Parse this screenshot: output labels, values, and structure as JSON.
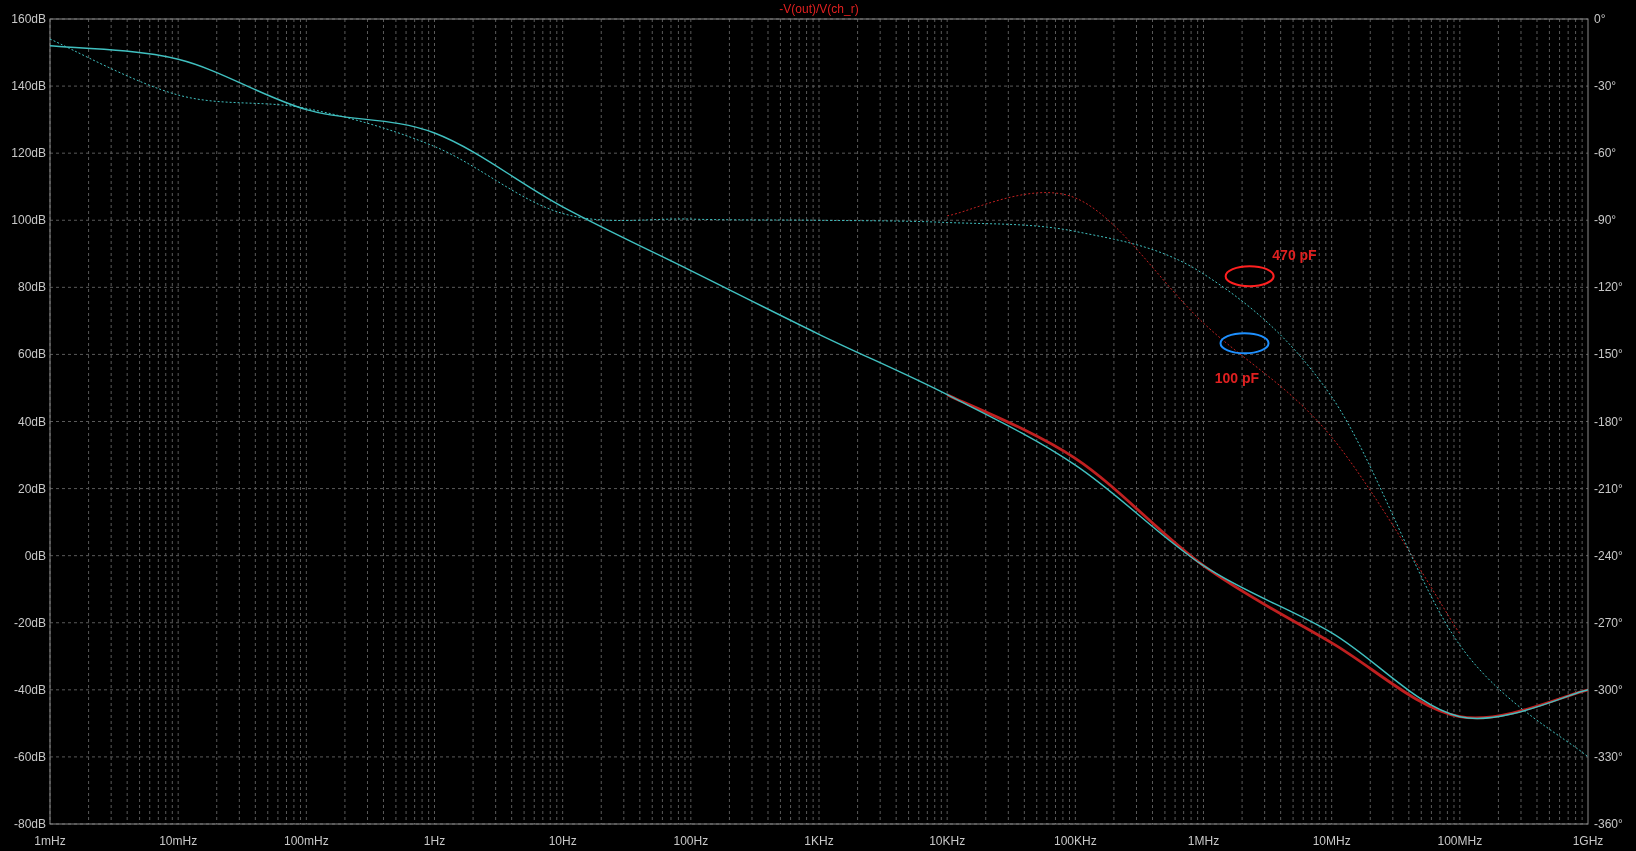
{
  "plot": {
    "title": "-V(out)/V(ch_r)",
    "chart_data": {
      "type": "line",
      "categories": [
        "1mHz",
        "10mHz",
        "100mHz",
        "1Hz",
        "10Hz",
        "100Hz",
        "1KHz",
        "10KHz",
        "100KHz",
        "1MHz",
        "10MHz",
        "100MHz",
        "1GHz"
      ],
      "ylim": [
        -80,
        160
      ],
      "yticks": [
        {
          "value": 160,
          "label": "160dB"
        },
        {
          "value": 140,
          "label": "140dB"
        },
        {
          "value": 120,
          "label": "120dB"
        },
        {
          "value": 100,
          "label": "100dB"
        },
        {
          "value": 80,
          "label": "80dB"
        },
        {
          "value": 60,
          "label": "60dB"
        },
        {
          "value": 40,
          "label": "40dB"
        },
        {
          "value": 20,
          "label": "20dB"
        },
        {
          "value": 0,
          "label": "0dB"
        },
        {
          "value": -20,
          "label": "-20dB"
        },
        {
          "value": -40,
          "label": "-40dB"
        },
        {
          "value": -60,
          "label": "-60dB"
        },
        {
          "value": -80,
          "label": "-80dB"
        }
      ],
      "y2lim": [
        -360,
        0
      ],
      "y2ticks": [
        {
          "value": 0,
          "label": "0°"
        },
        {
          "value": -30,
          "label": "-30°"
        },
        {
          "value": -60,
          "label": "-60°"
        },
        {
          "value": -90,
          "label": "-90°"
        },
        {
          "value": -120,
          "label": "-120°"
        },
        {
          "value": -150,
          "label": "-150°"
        },
        {
          "value": -180,
          "label": "-180°"
        },
        {
          "value": -210,
          "label": "-210°"
        },
        {
          "value": -240,
          "label": "-240°"
        },
        {
          "value": -270,
          "label": "-270°"
        },
        {
          "value": -300,
          "label": "-300°"
        },
        {
          "value": -330,
          "label": "-330°"
        },
        {
          "value": -360,
          "label": "-360°"
        }
      ],
      "series": [
        {
          "color": "#c02020",
          "values": [
            null,
            null,
            null,
            null,
            null,
            null,
            null,
            48,
            29,
            -3,
            -26,
            -48,
            -40
          ]
        },
        {
          "color": "#40c0c0",
          "values": [
            152,
            148,
            133,
            126,
            104,
            85,
            66,
            48,
            27,
            -3,
            -23,
            -48,
            -40
          ]
        },
        {
          "color": "#c02020",
          "axis": "y2",
          "line_style": "dashed",
          "values": [
            null,
            null,
            null,
            null,
            null,
            null,
            null,
            -88,
            -80,
            -136,
            -187,
            -275,
            null
          ]
        },
        {
          "color": "#40c0c0",
          "axis": "y2",
          "line_style": "dashed",
          "values": [
            -9,
            -34,
            -40,
            -57,
            -87,
            -89.5,
            -90,
            -91,
            -95,
            -114,
            -169,
            -280,
            -330
          ]
        }
      ],
      "grid": true,
      "annotations": [
        "470 pF",
        "100 pF"
      ]
    }
  }
}
